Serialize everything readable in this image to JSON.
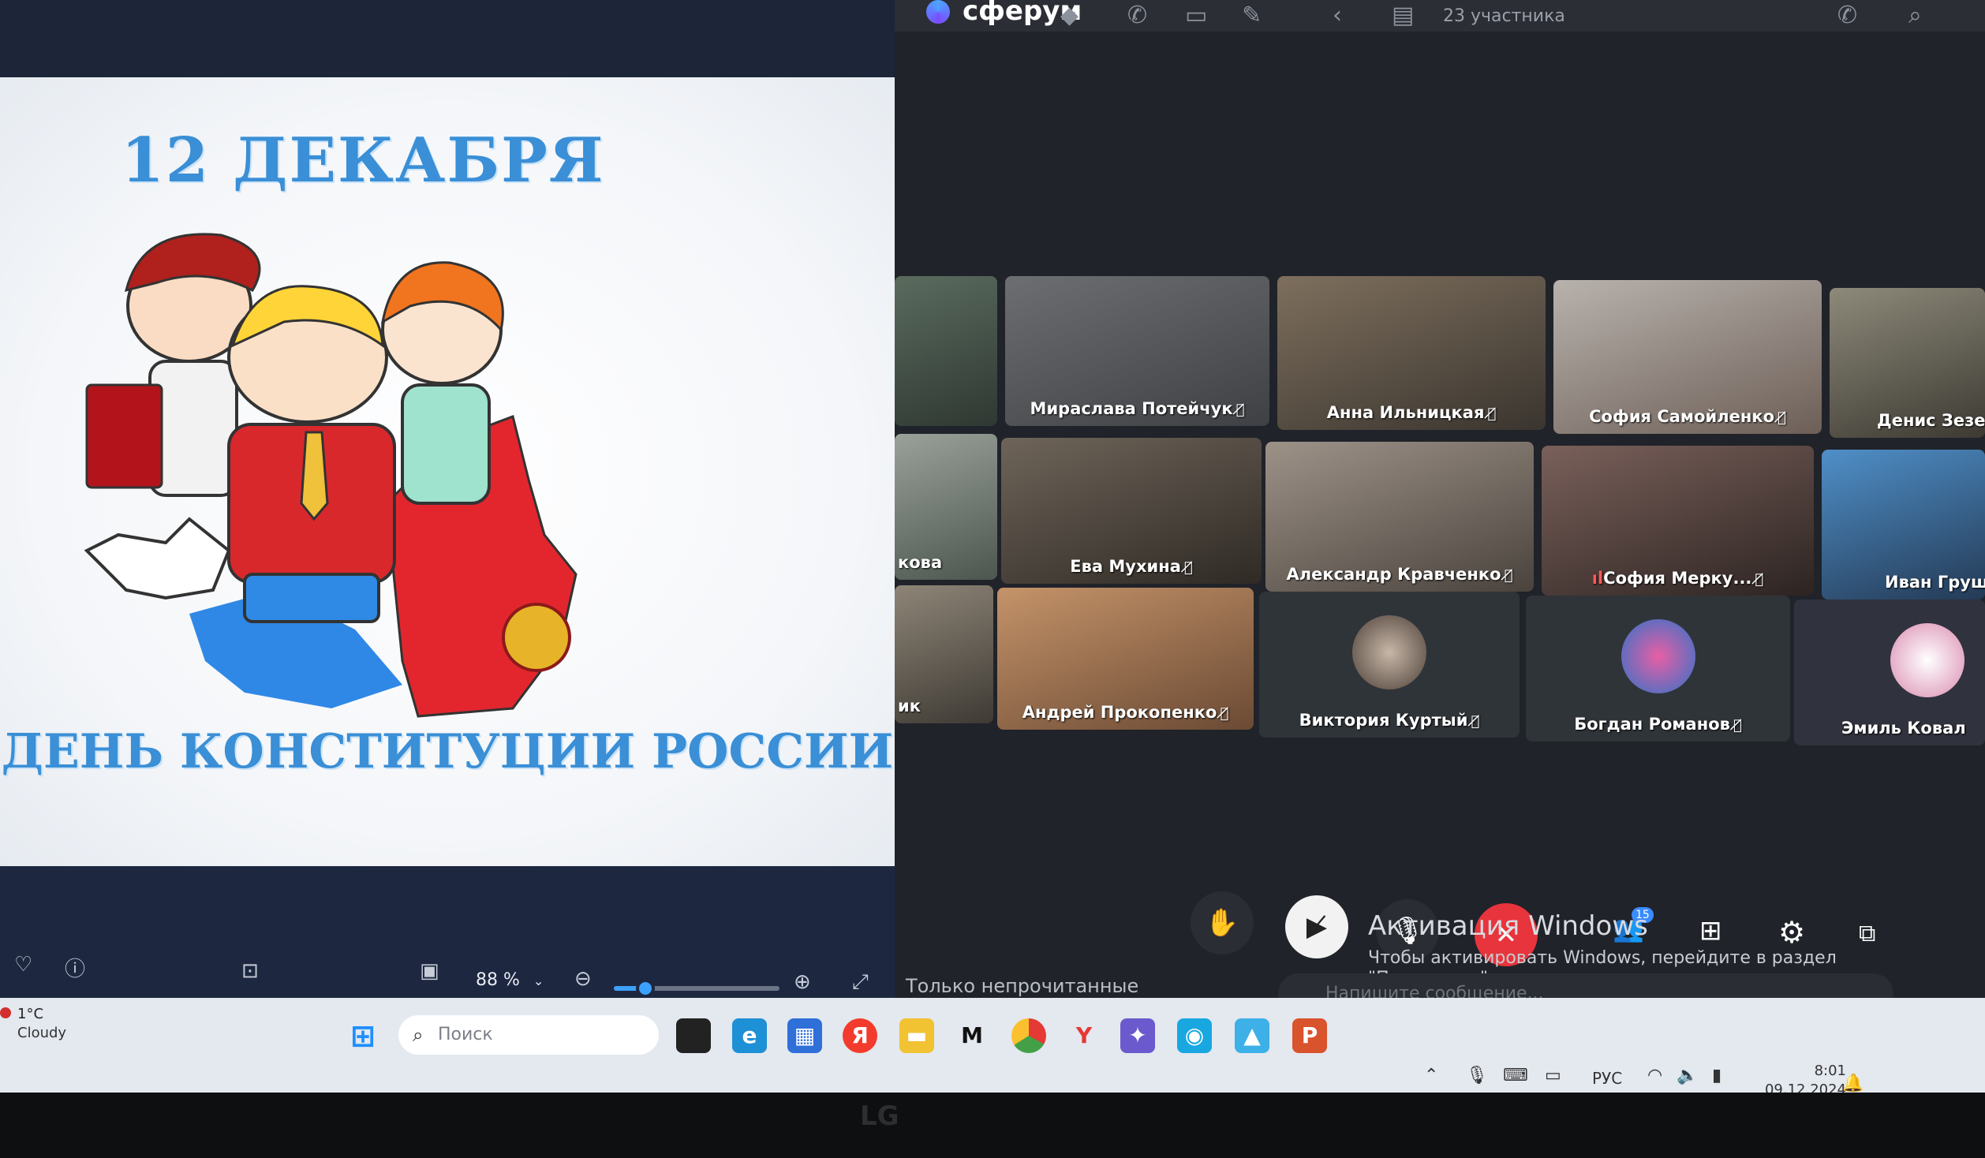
{
  "viewer": {
    "slide": {
      "date": "12 ДЕКАБРЯ",
      "caption": "ДЕНЬ КОНСТИТУЦИИ РОССИИ"
    },
    "toolbar": {
      "zoom": "88 %",
      "icons": [
        "heart-icon",
        "info-icon",
        "face-scan-icon",
        "image-icon",
        "zoom-out-icon",
        "zoom-in-icon",
        "fullscreen-icon"
      ]
    }
  },
  "call": {
    "app_name": "сферум",
    "participants_count": "23 участника",
    "tiles": [
      {
        "name": "Мираслава Потейчук"
      },
      {
        "name": "Анна Ильницкая"
      },
      {
        "name": "София Самойленко"
      },
      {
        "name": "Денис Зезе"
      },
      {
        "name": "кова"
      },
      {
        "name": "Ева Мухина"
      },
      {
        "name": "Александр Кравченко"
      },
      {
        "name": "София Мерку..."
      },
      {
        "name": "Иван Груш"
      },
      {
        "name": "ик"
      },
      {
        "name": "Андрей Прокопенко"
      },
      {
        "name": "Виктория Куртый"
      },
      {
        "name": "Богдан Романов"
      },
      {
        "name": "Эмиль Ковал"
      }
    ],
    "controls": {
      "participants_badge": "15"
    },
    "watermark": {
      "title": "Активация Windows",
      "text": "Чтобы активировать Windows, перейдите в раздел \"Параметры\"."
    },
    "unread_label": "Только непрочитанные",
    "message_placeholder": "Напишите сообщение..."
  },
  "taskbar": {
    "weather_temp": "1°C",
    "weather_desc": "Cloudy",
    "search_placeholder": "Поиск",
    "lang": "РУС",
    "time": "8:01",
    "date": "09.12.2024"
  },
  "bezel_logo": "LG"
}
